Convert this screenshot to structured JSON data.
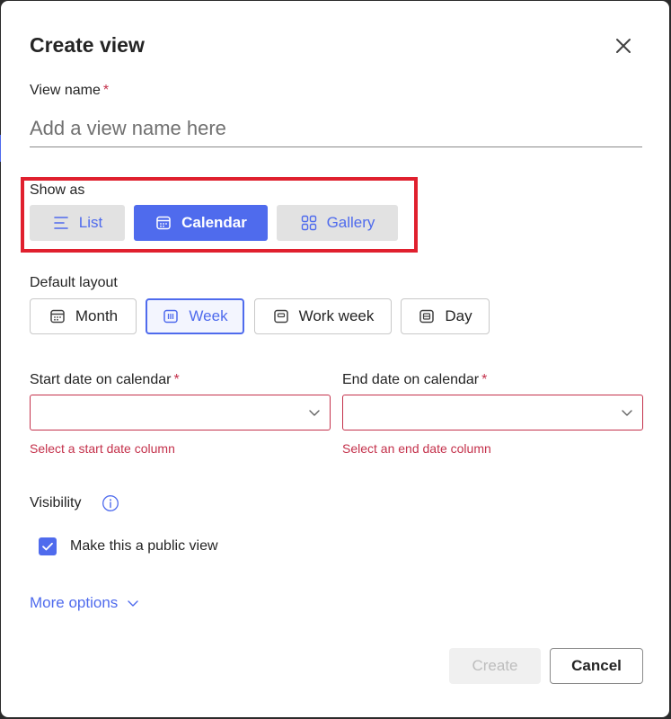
{
  "dialog": {
    "title": "Create view",
    "view_name": {
      "label": "View name",
      "required_mark": "*",
      "placeholder": "Add a view name here",
      "value": ""
    },
    "show_as": {
      "label": "Show as",
      "options": [
        {
          "label": "List",
          "icon": "list-icon"
        },
        {
          "label": "Calendar",
          "icon": "calendar-icon",
          "selected": true
        },
        {
          "label": "Gallery",
          "icon": "gallery-icon"
        }
      ]
    },
    "default_layout": {
      "label": "Default layout",
      "options": [
        {
          "label": "Month",
          "icon": "month-icon"
        },
        {
          "label": "Week",
          "icon": "week-icon",
          "selected": true
        },
        {
          "label": "Work week",
          "icon": "work-week-icon"
        },
        {
          "label": "Day",
          "icon": "day-icon"
        }
      ]
    },
    "start_date": {
      "label": "Start date on calendar",
      "required_mark": "*",
      "value": "",
      "error": "Select a start date column"
    },
    "end_date": {
      "label": "End date on calendar",
      "required_mark": "*",
      "value": "",
      "error": "Select an end date column"
    },
    "visibility": {
      "label": "Visibility",
      "public_checkbox": {
        "label": "Make this a public view",
        "checked": true
      }
    },
    "more_options": "More options",
    "buttons": {
      "create": "Create",
      "cancel": "Cancel"
    },
    "colors": {
      "accent": "#4f6bed",
      "error": "#c4314b",
      "highlight": "#e0202e"
    }
  }
}
